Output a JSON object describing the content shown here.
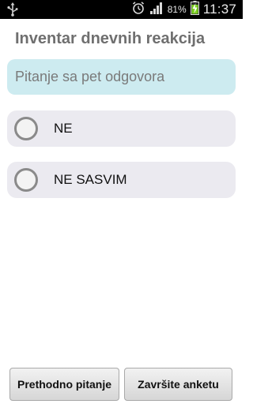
{
  "status_bar": {
    "icons": [
      "usb-icon",
      "alarm-icon",
      "signal-icon",
      "battery-charging-icon"
    ],
    "battery_percent": "81%",
    "time": "11:37"
  },
  "header": {
    "title": "Inventar dnevnih reakcija"
  },
  "question": {
    "text": "Pitanje sa pet odgovora"
  },
  "answers": [
    {
      "label": "NE",
      "selected": false
    },
    {
      "label": "NE SASVIM",
      "selected": false
    }
  ],
  "footer": {
    "previous_label": "Prethodno pitanje",
    "finish_label": "Završite anketu"
  },
  "colors": {
    "question_bg": "#cdebf0",
    "answer_bg": "#ebeaf0",
    "battery_bolt": "#7ed321"
  }
}
